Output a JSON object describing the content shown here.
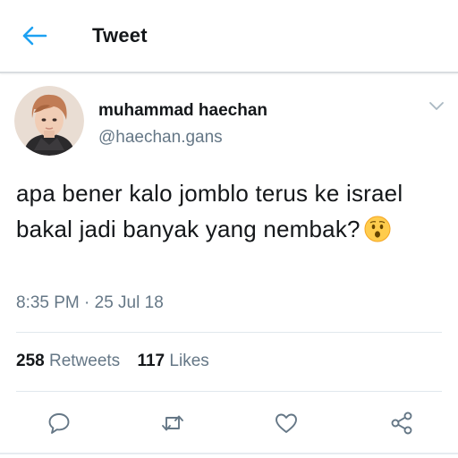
{
  "header": {
    "title": "Tweet",
    "back_icon": "arrow-left-icon",
    "accent_color": "#1da1f2"
  },
  "tweet": {
    "author": {
      "display_name": "muhammad haechan",
      "handle": "@haechan.gans"
    },
    "text": "apa bener kalo jomblo terus ke israel bakal jadi banyak yang nembak?",
    "emoji": "hushed-face-emoji",
    "timestamp": "8:35 PM · 25 Jul 18",
    "stats": {
      "retweets_count": "258",
      "retweets_label": "Retweets",
      "likes_count": "117",
      "likes_label": "Likes"
    }
  },
  "actions": {
    "reply_icon": "reply-icon",
    "retweet_icon": "retweet-icon",
    "like_icon": "heart-icon",
    "share_icon": "share-icon"
  },
  "colors": {
    "text_primary": "#14171a",
    "text_secondary": "#657786",
    "divider": "#e1e8ed"
  }
}
